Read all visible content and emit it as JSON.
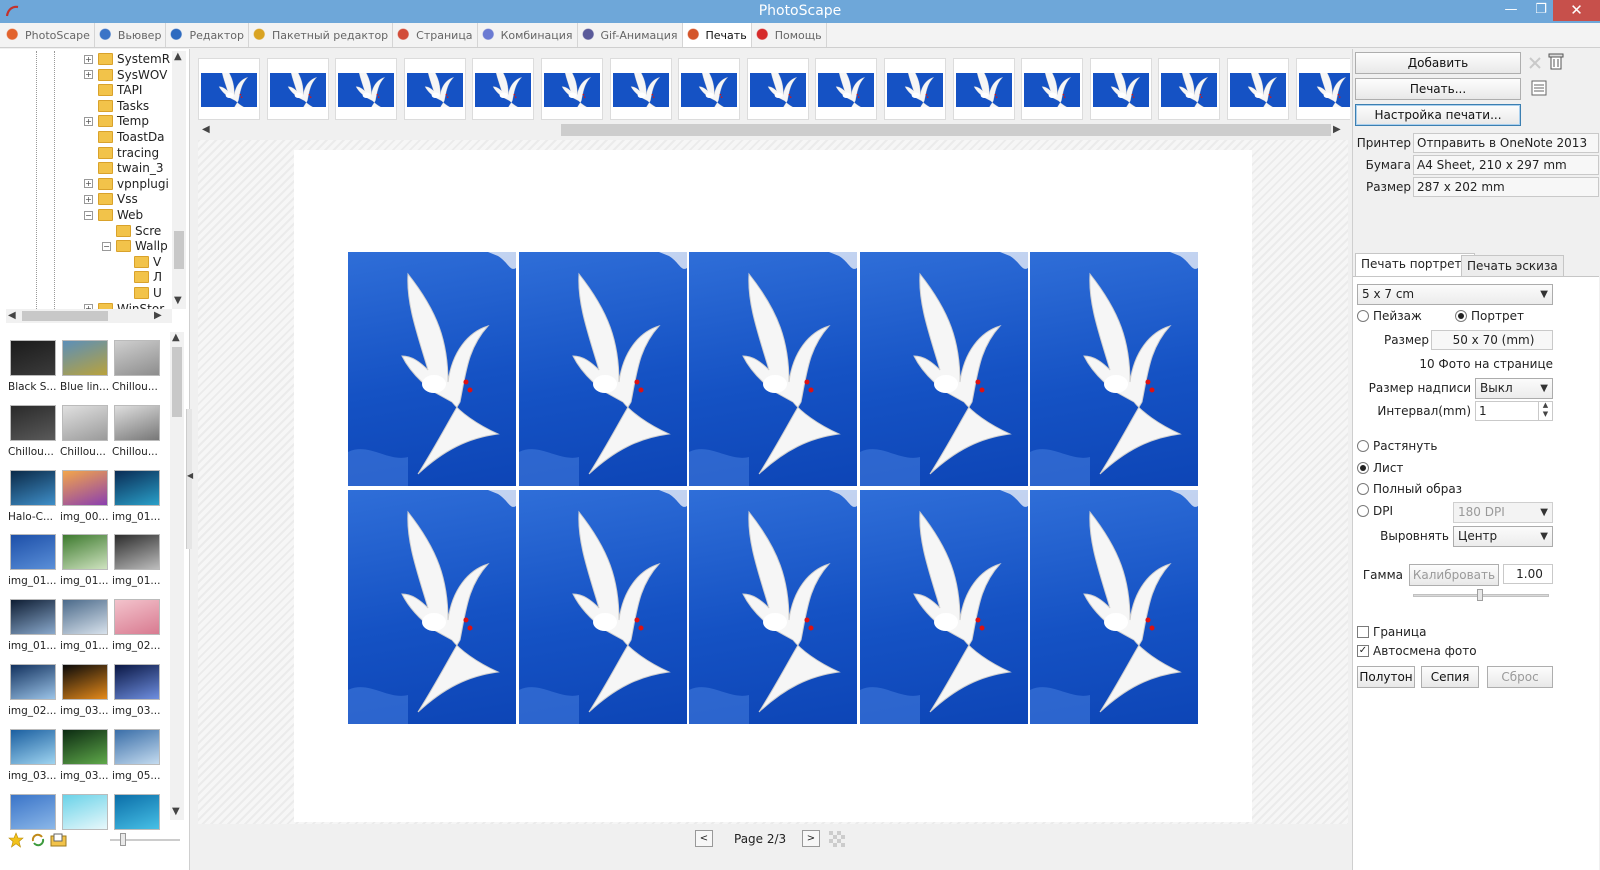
{
  "window": {
    "title": "PhotoScape",
    "minimize": "—",
    "maximize": "❐",
    "close": "✕"
  },
  "tabs": [
    {
      "label": "PhotoScape",
      "icon": "photoscape-icon",
      "color": "#e2632d"
    },
    {
      "label": "Вьювер",
      "icon": "viewer-icon",
      "color": "#3b74c7"
    },
    {
      "label": "Редактор",
      "icon": "editor-icon",
      "color": "#2e6bc0"
    },
    {
      "label": "Пакетный редактор",
      "icon": "batch-editor-icon",
      "color": "#d9a322"
    },
    {
      "label": "Страница",
      "icon": "page-icon",
      "color": "#d24d39"
    },
    {
      "label": "Комбинация",
      "icon": "combine-icon",
      "color": "#6b7bd3"
    },
    {
      "label": "Gif-Анимация",
      "icon": "gif-icon",
      "color": "#5a5a9a"
    },
    {
      "label": "Печать",
      "icon": "print-icon",
      "color": "#d4552a",
      "active": true
    },
    {
      "label": "Помощь",
      "icon": "help-icon",
      "color": "#d62b2b"
    }
  ],
  "tree": [
    {
      "label": "SystemR",
      "expander": "+"
    },
    {
      "label": "SysWOV",
      "expander": "+"
    },
    {
      "label": "TAPI",
      "expander": ""
    },
    {
      "label": "Tasks",
      "expander": ""
    },
    {
      "label": "Temp",
      "expander": "+"
    },
    {
      "label": "ToastDa",
      "expander": ""
    },
    {
      "label": "tracing",
      "expander": ""
    },
    {
      "label": "twain_3",
      "expander": ""
    },
    {
      "label": "vpnplugi",
      "expander": "+"
    },
    {
      "label": "Vss",
      "expander": "+"
    },
    {
      "label": "Web",
      "expander": "−"
    },
    {
      "label": "Scre",
      "expander": "",
      "level": 1
    },
    {
      "label": "Wallp",
      "expander": "−",
      "level": 1
    },
    {
      "label": "V",
      "expander": "",
      "level": 2
    },
    {
      "label": "Л",
      "expander": "",
      "level": 2
    },
    {
      "label": "U",
      "expander": "",
      "level": 2
    },
    {
      "label": "WinStor",
      "expander": "+"
    }
  ],
  "thumbnails": [
    {
      "label": "Black S...",
      "colors": [
        "#1b1b1b",
        "#3b3b3b"
      ]
    },
    {
      "label": "Blue lin...",
      "colors": [
        "#5b8fb9",
        "#b9a23c"
      ]
    },
    {
      "label": "Chillou...",
      "colors": [
        "#cfcfcf",
        "#8d8d8d"
      ]
    },
    {
      "label": "Chillou...",
      "colors": [
        "#2a2a2a",
        "#5a5a5a"
      ]
    },
    {
      "label": "Chillou...",
      "colors": [
        "#e0e0e0",
        "#9a9a9a"
      ]
    },
    {
      "label": "Chillou...",
      "colors": [
        "#dedede",
        "#777777"
      ]
    },
    {
      "label": "Halo-C...",
      "colors": [
        "#0b2a48",
        "#3f8fc9"
      ]
    },
    {
      "label": "img_00...",
      "colors": [
        "#f3a64a",
        "#8a3fb0"
      ]
    },
    {
      "label": "img_01...",
      "colors": [
        "#0a2c55",
        "#2aa0c9"
      ]
    },
    {
      "label": "img_01...",
      "colors": [
        "#1d4fa8",
        "#5a8fd8"
      ]
    },
    {
      "label": "img_01...",
      "colors": [
        "#3d7a2e",
        "#cfe3c0"
      ]
    },
    {
      "label": "img_01...",
      "colors": [
        "#2c2c2c",
        "#bdbdbd"
      ]
    },
    {
      "label": "img_01...",
      "colors": [
        "#0e1d33",
        "#8aa9cc"
      ]
    },
    {
      "label": "img_01...",
      "colors": [
        "#4b6a8a",
        "#d8e2ec"
      ]
    },
    {
      "label": "img_02...",
      "colors": [
        "#f3c3cc",
        "#d87a90"
      ]
    },
    {
      "label": "img_02...",
      "colors": [
        "#12315e",
        "#9cc4e8"
      ]
    },
    {
      "label": "img_03...",
      "colors": [
        "#0a0a0a",
        "#e58a1a"
      ]
    },
    {
      "label": "img_03...",
      "colors": [
        "#0a1744",
        "#6f8fe0"
      ]
    },
    {
      "label": "img_03...",
      "colors": [
        "#1b5fa0",
        "#9fd4f0"
      ]
    },
    {
      "label": "img_03...",
      "colors": [
        "#0c2b12",
        "#5fa94a"
      ]
    },
    {
      "label": "img_05...",
      "colors": [
        "#3a6ea8",
        "#c4dbef"
      ]
    },
    {
      "label": "",
      "colors": [
        "#3a74c8",
        "#8bb7e8"
      ]
    },
    {
      "label": "",
      "colors": [
        "#6ad2e8",
        "#e8f8fb"
      ]
    },
    {
      "label": "",
      "colors": [
        "#0b6ea8",
        "#47c0e6"
      ]
    }
  ],
  "film_count": 17,
  "preview": {
    "photo_count": 10,
    "background": "#1552c4"
  },
  "pager": {
    "prev": "<",
    "label": "Page 2/3",
    "next": ">"
  },
  "right": {
    "add_button": "Добавить",
    "print_button": "Печать...",
    "print_setup_button": "Настройка печати...",
    "printer_label": "Принтер",
    "printer_value": "Отправить в OneNote 2013",
    "paper_label": "Бумага",
    "paper_value": "A4 Sheet, 210 x 297 mm",
    "size_label": "Размер",
    "size_value": "287 x 202 mm",
    "tab_portrait": "Печать портрета",
    "tab_thumbs": "Печать эскиза",
    "format_value": "5 x 7 cm",
    "landscape": "Пейзаж",
    "portrait": "Портрет",
    "photo_size_label": "Размер",
    "photo_size_value": "50 x 70 (mm)",
    "photos_per_page": "10 Фото на странице",
    "caption_size_label": "Размер надписи",
    "caption_size_value": "Выкл",
    "interval_label": "Интервал(mm)",
    "interval_value": "1",
    "stretch": "Растянуть",
    "sheet": "Лист",
    "full_image": "Полный образ",
    "dpi": "DPI",
    "dpi_value": "180 DPI",
    "align_label": "Выровнять",
    "align_value": "Центр",
    "gamma_label": "Гамма",
    "calibrate_button": "Калибровать",
    "gamma_value": "1.00",
    "border": "Граница",
    "auto_rotate": "Автосмена фото",
    "halftone_button": "Полутон",
    "sepia_button": "Сепия",
    "reset_button": "Сброс"
  }
}
